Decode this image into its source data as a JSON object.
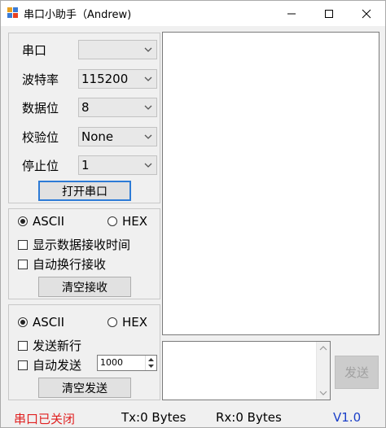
{
  "window": {
    "title": "串口小助手（Andrew)",
    "accent_color": "#2d7bd6"
  },
  "port_settings": {
    "port_label": "串口",
    "port_value": "",
    "baud_label": "波特率",
    "baud_value": "115200",
    "databits_label": "数据位",
    "databits_value": "8",
    "parity_label": "校验位",
    "parity_value": "None",
    "stopbits_label": "停止位",
    "stopbits_value": "1",
    "open_button": "打开串口"
  },
  "receive": {
    "ascii_label": "ASCII",
    "hex_label": "HEX",
    "selected_mode": "ASCII",
    "show_time_label": "显示数据接收时间",
    "show_time_checked": false,
    "auto_newline_label": "自动换行接收",
    "auto_newline_checked": false,
    "clear_button": "清空接收",
    "text": ""
  },
  "send": {
    "ascii_label": "ASCII",
    "hex_label": "HEX",
    "selected_mode": "ASCII",
    "newline_label": "发送新行",
    "newline_checked": false,
    "auto_send_label": "自动发送",
    "auto_send_checked": false,
    "interval_value": "1000",
    "clear_button": "清空发送",
    "send_button": "发送",
    "text": ""
  },
  "status_bar": {
    "port_status": "串口已关闭",
    "port_status_color": "#e02020",
    "tx": "Tx:0 Bytes",
    "rx": "Rx:0 Bytes",
    "version": "V1.0",
    "version_color": "#1a3fc8"
  }
}
